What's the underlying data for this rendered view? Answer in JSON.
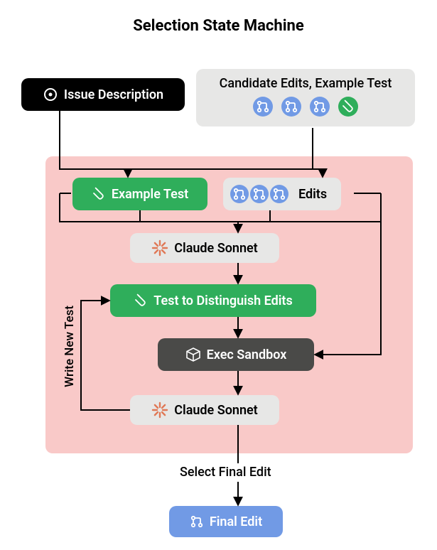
{
  "title": "Selection State Machine",
  "inputs": {
    "issue": {
      "label": "Issue Description"
    },
    "candidates": {
      "label": "Candidate Edits, Example Test"
    }
  },
  "machine": {
    "example_test": {
      "label": "Example Test"
    },
    "edits": {
      "label": "Edits"
    },
    "sonnet_top": {
      "label": "Claude Sonnet"
    },
    "distinguish": {
      "label": "Test to Distinguish Edits"
    },
    "sandbox": {
      "label": "Exec Sandbox"
    },
    "sonnet_bottom": {
      "label": "Claude Sonnet"
    },
    "loop_label": "Write New Test"
  },
  "outputs": {
    "select_label": "Select Final Edit",
    "final": {
      "label": "Final Edit"
    }
  },
  "colors": {
    "black": "#000000",
    "lightgray": "#e7e7e6",
    "green": "#2fae5b",
    "darkgray": "#4a4a48",
    "blue": "#719ae5",
    "pink": "#f9c9c8",
    "orange": "#e07856"
  },
  "icons": {
    "issue": "circle-dot-icon",
    "edit": "pull-request-icon",
    "test": "test-tube-icon",
    "model": "starburst-icon",
    "sandbox": "cube-icon"
  }
}
